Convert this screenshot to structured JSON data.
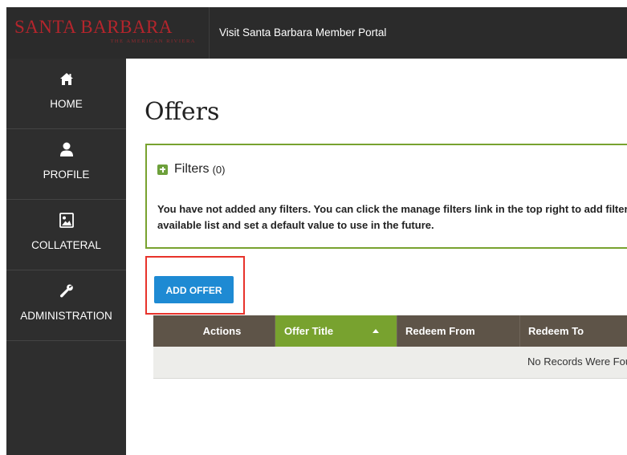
{
  "header": {
    "logo_main": "SANTA BARBARA",
    "logo_sub": "THE AMERICAN RIVIERA",
    "portal_title": "Visit Santa Barbara Member Portal"
  },
  "sidebar": {
    "items": [
      {
        "label": "HOME",
        "icon": "home-icon"
      },
      {
        "label": "PROFILE",
        "icon": "user-icon"
      },
      {
        "label": "COLLATERAL",
        "icon": "image-icon"
      },
      {
        "label": "ADMINISTRATION",
        "icon": "wrench-icon"
      }
    ]
  },
  "main": {
    "title": "Offers",
    "filters": {
      "title": "Filters",
      "count": "(0)",
      "message": "You have not added any filters. You can click the manage filters link in the top right to add filters from the available list and set a default value to use in the future."
    },
    "add_button": "ADD OFFER",
    "table": {
      "columns": [
        "Actions",
        "Offer Title",
        "Redeem From",
        "Redeem To"
      ],
      "sorted_column": "Offer Title",
      "empty_message": "No Records Were Found"
    }
  },
  "colors": {
    "topbar": "#2b2b2b",
    "sidebar": "#2e2e2e",
    "logo": "#b4252c",
    "accent_green": "#78a22f",
    "button_blue": "#1e8ad3",
    "table_header": "#5e5448",
    "highlight_red": "#e8332b"
  }
}
